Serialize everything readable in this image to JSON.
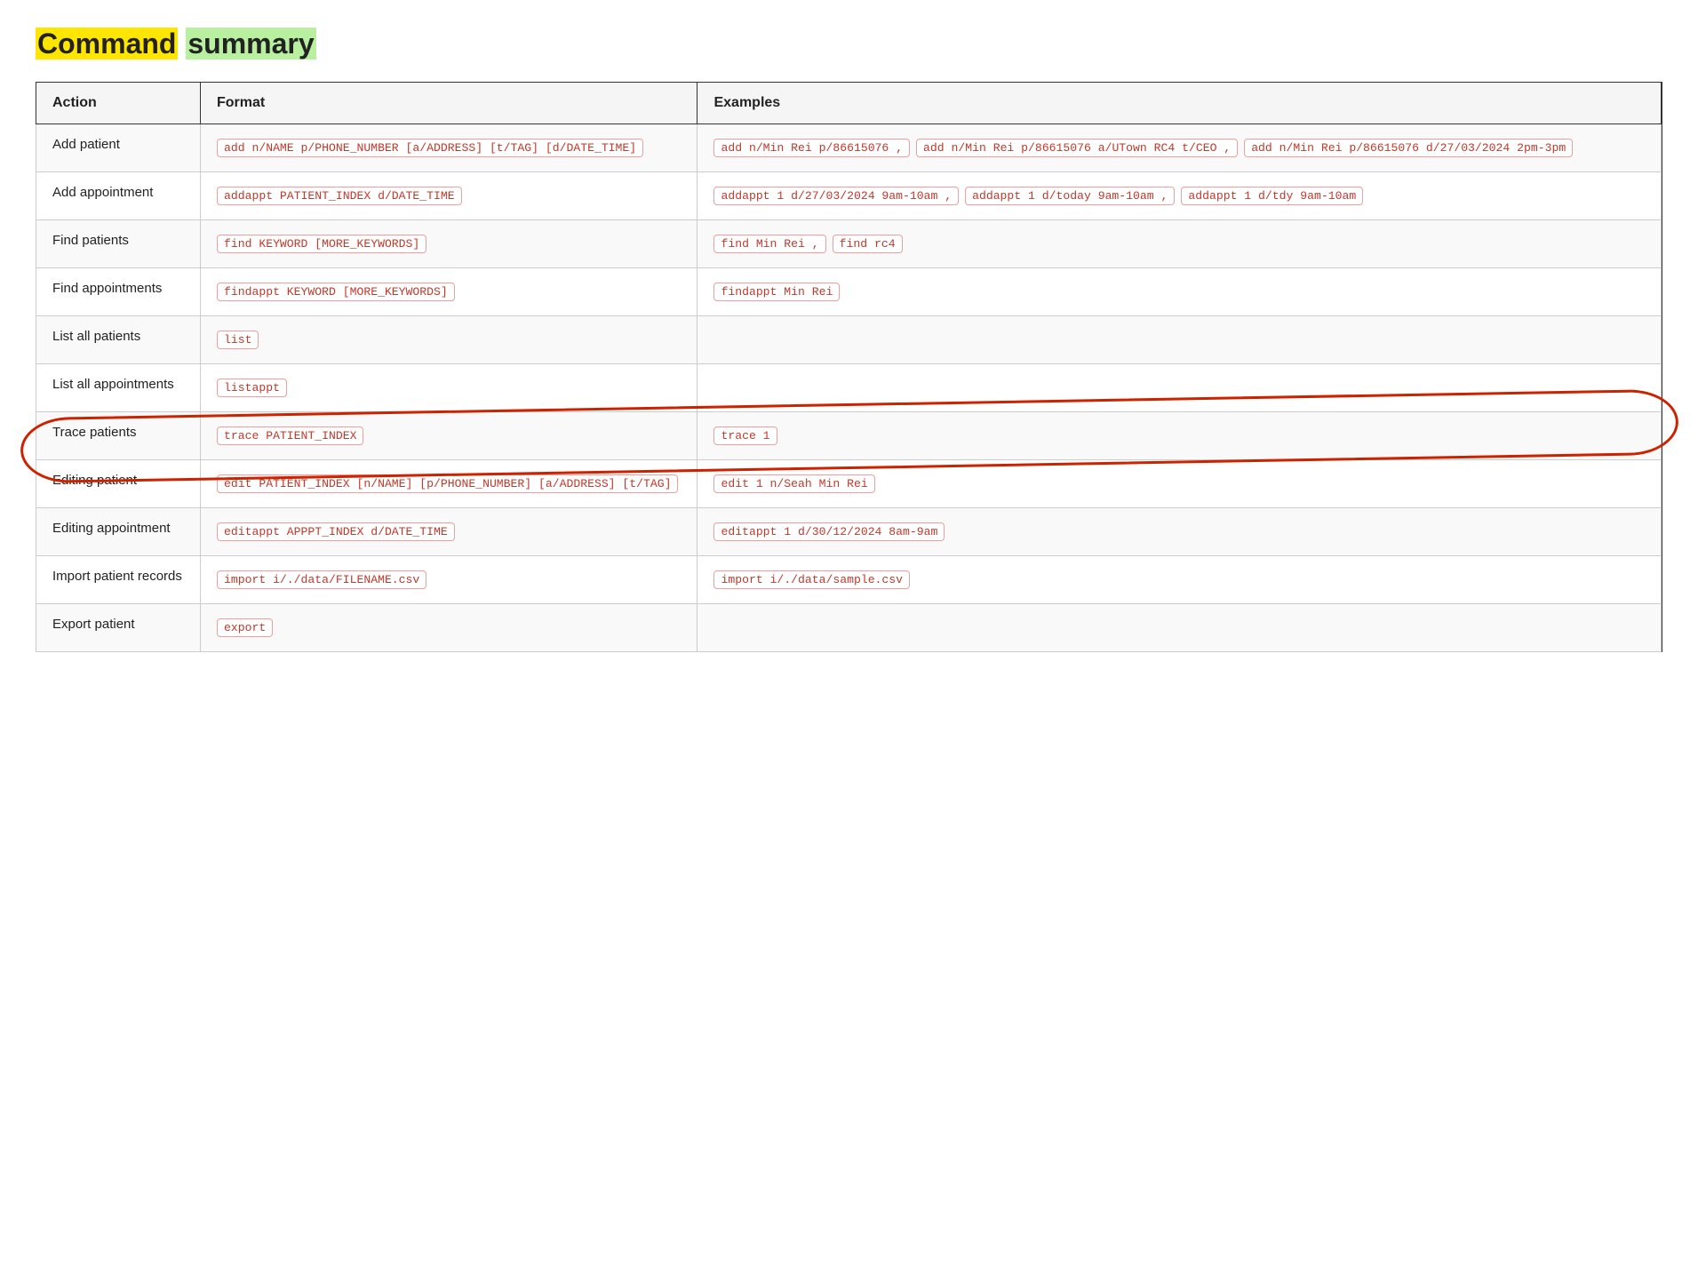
{
  "page": {
    "title_part1": "Command",
    "title_part2": "summary"
  },
  "table": {
    "headers": [
      "Action",
      "Format",
      "Examples"
    ],
    "rows": [
      {
        "action": "Add patient",
        "format": [
          "add n/NAME p/PHONE_NUMBER [a/ADDRESS] [t/TAG] [d/DATE_TIME]"
        ],
        "examples": [
          "add n/Min Rei p/86615076 ,",
          "add n/Min Rei p/86615076 a/UTown RC4 t/CEO ,",
          "add n/Min Rei p/86615076 d/27/03/2024 2pm-3pm"
        ],
        "trace": false
      },
      {
        "action": "Add appointment",
        "format": [
          "addappt PATIENT_INDEX d/DATE_TIME"
        ],
        "examples": [
          "addappt 1 d/27/03/2024 9am-10am ,",
          "addappt 1 d/today 9am-10am ,",
          "addappt 1 d/tdy 9am-10am"
        ],
        "trace": false
      },
      {
        "action": "Find patients",
        "format": [
          "find KEYWORD [MORE_KEYWORDS]"
        ],
        "examples": [
          "find Min Rei ,",
          "find rc4"
        ],
        "trace": false
      },
      {
        "action": "Find appointments",
        "format": [
          "findappt KEYWORD [MORE_KEYWORDS]"
        ],
        "examples": [
          "findappt Min Rei"
        ],
        "trace": false
      },
      {
        "action": "List all patients",
        "format": [
          "list"
        ],
        "examples": [],
        "trace": false
      },
      {
        "action": "List all appointments",
        "format": [
          "listappt"
        ],
        "examples": [],
        "trace": false
      },
      {
        "action": "Trace patients",
        "format": [
          "trace PATIENT_INDEX"
        ],
        "examples": [
          "trace 1"
        ],
        "trace": true
      },
      {
        "action": "Editing patient",
        "format": [
          "edit PATIENT_INDEX [n/NAME] [p/PHONE_NUMBER] [a/ADDRESS] [t/TAG]"
        ],
        "examples": [
          "edit 1 n/Seah Min Rei"
        ],
        "trace": false
      },
      {
        "action": "Editing appointment",
        "format": [
          "editappt APPPT_INDEX d/DATE_TIME"
        ],
        "examples": [
          "editappt 1 d/30/12/2024 8am-9am"
        ],
        "trace": false
      },
      {
        "action": "Import patient records",
        "format": [
          "import i/./data/FILENAME.csv"
        ],
        "examples": [
          "import i/./data/sample.csv"
        ],
        "trace": false
      },
      {
        "action": "Export patient",
        "format": [
          "export"
        ],
        "examples": [],
        "trace": false
      }
    ]
  }
}
